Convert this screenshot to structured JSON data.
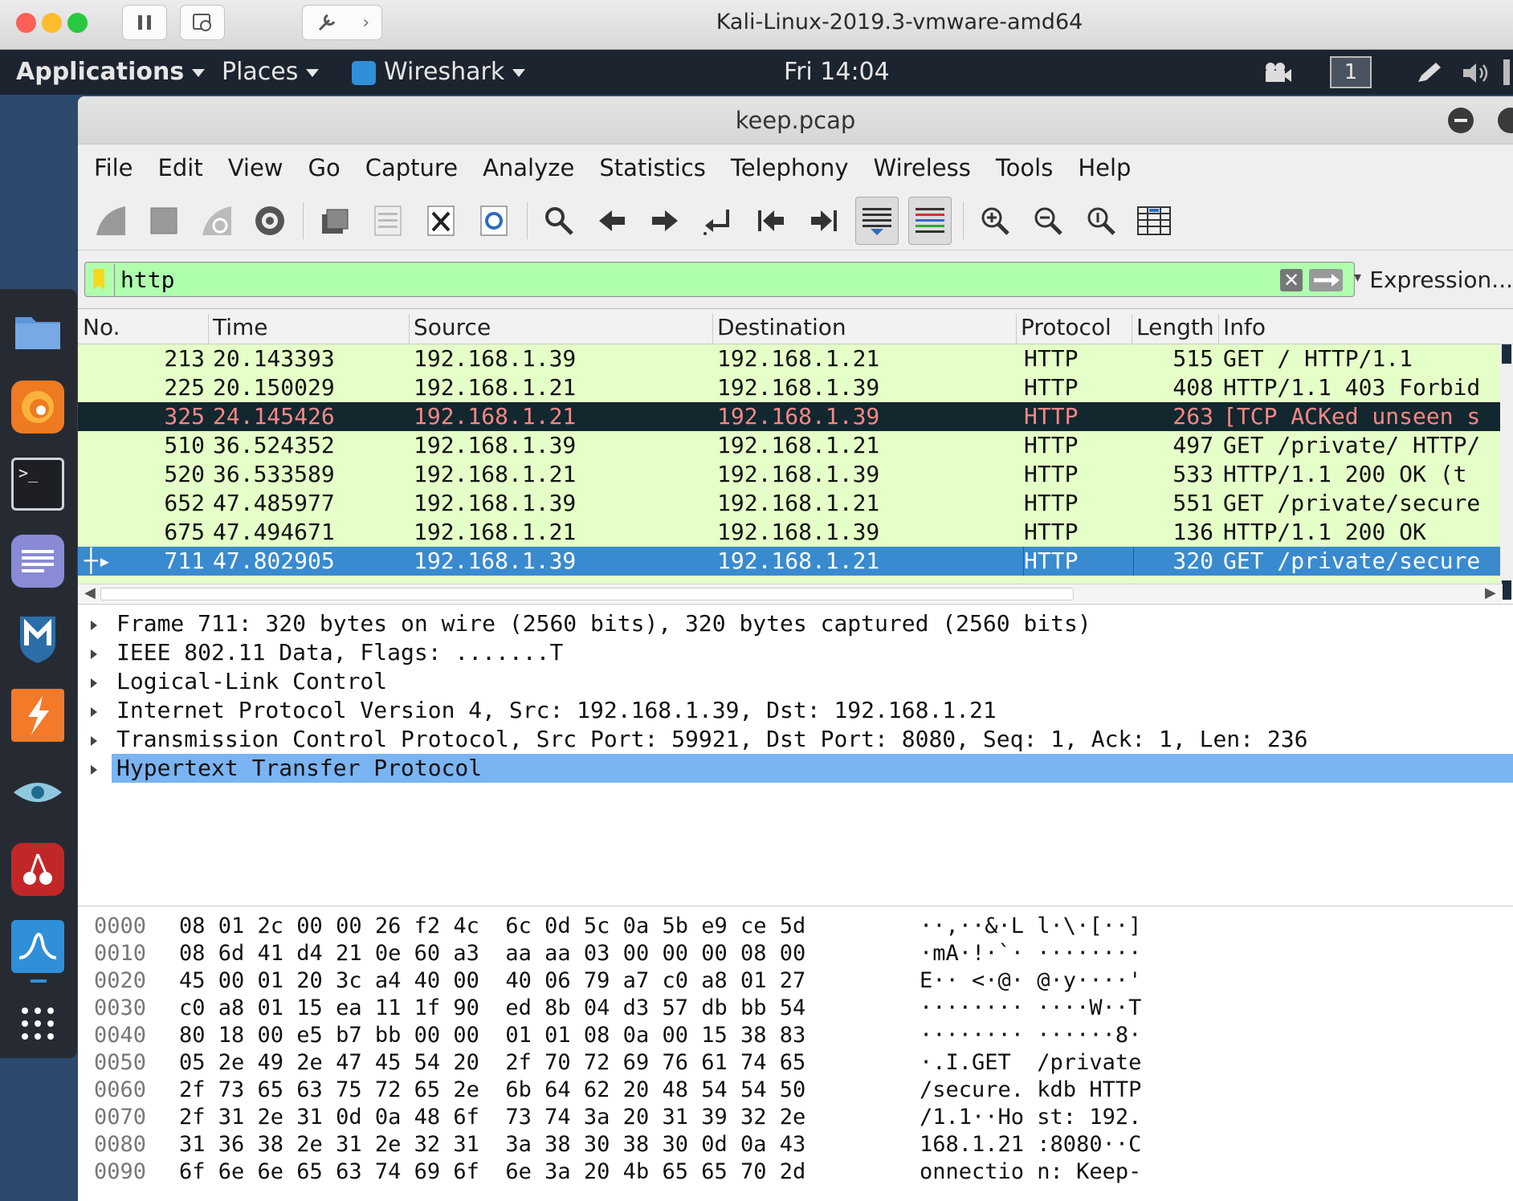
{
  "vm": {
    "title": "Kali-Linux-2019.3-vmware-amd64"
  },
  "gnome": {
    "applications": "Applications",
    "places": "Places",
    "app": "Wireshark",
    "clock": "Fri 14:04",
    "workspace": "1"
  },
  "window": {
    "title": "keep.pcap"
  },
  "menu": {
    "file": "File",
    "edit": "Edit",
    "view": "View",
    "go": "Go",
    "capture": "Capture",
    "analyze": "Analyze",
    "statistics": "Statistics",
    "telephony": "Telephony",
    "wireless": "Wireless",
    "tools": "Tools",
    "help": "Help"
  },
  "filter": {
    "value": "http",
    "expression": "Expression..."
  },
  "columns": {
    "no": "No.",
    "time": "Time",
    "source": "Source",
    "destination": "Destination",
    "protocol": "Protocol",
    "length": "Length",
    "info": "Info"
  },
  "packets": [
    {
      "no": "213",
      "time": "20.143393",
      "src": "192.168.1.39",
      "dst": "192.168.1.21",
      "proto": "HTTP",
      "len": "515",
      "info": "GET / HTTP/1.1",
      "style": "normal"
    },
    {
      "no": "225",
      "time": "20.150029",
      "src": "192.168.1.21",
      "dst": "192.168.1.39",
      "proto": "HTTP",
      "len": "408",
      "info": "HTTP/1.1 403 Forbid",
      "style": "normal"
    },
    {
      "no": "325",
      "time": "24.145426",
      "src": "192.168.1.21",
      "dst": "192.168.1.39",
      "proto": "HTTP",
      "len": "263",
      "info": "[TCP ACKed unseen s",
      "style": "bad"
    },
    {
      "no": "510",
      "time": "36.524352",
      "src": "192.168.1.39",
      "dst": "192.168.1.21",
      "proto": "HTTP",
      "len": "497",
      "info": "GET /private/ HTTP/",
      "style": "normal"
    },
    {
      "no": "520",
      "time": "36.533589",
      "src": "192.168.1.21",
      "dst": "192.168.1.39",
      "proto": "HTTP",
      "len": "533",
      "info": "HTTP/1.1 200 OK  (t",
      "style": "normal"
    },
    {
      "no": "652",
      "time": "47.485977",
      "src": "192.168.1.39",
      "dst": "192.168.1.21",
      "proto": "HTTP",
      "len": "551",
      "info": "GET /private/secure",
      "style": "normal"
    },
    {
      "no": "675",
      "time": "47.494671",
      "src": "192.168.1.21",
      "dst": "192.168.1.39",
      "proto": "HTTP",
      "len": "136",
      "info": "HTTP/1.1 200 OK",
      "style": "normal"
    },
    {
      "no": "711",
      "time": "47.802905",
      "src": "192.168.1.39",
      "dst": "192.168.1.21",
      "proto": "HTTP",
      "len": "320",
      "info": "GET /private/secure",
      "style": "selected"
    }
  ],
  "details": [
    "Frame 711: 320 bytes on wire (2560 bits), 320 bytes captured (2560 bits)",
    "IEEE 802.11 Data, Flags: .......T",
    "Logical-Link Control",
    "Internet Protocol Version 4, Src: 192.168.1.39, Dst: 192.168.1.21",
    "Transmission Control Protocol, Src Port: 59921, Dst Port: 8080, Seq: 1, Ack: 1, Len: 236",
    "Hypertext Transfer Protocol"
  ],
  "hex": [
    {
      "off": "0000",
      "bytes": "08 01 2c 00 00 26 f2 4c  6c 0d 5c 0a 5b e9 ce 5d",
      "ascii": "··,··&·L l·\\·[··]"
    },
    {
      "off": "0010",
      "bytes": "08 6d 41 d4 21 0e 60 a3  aa aa 03 00 00 00 08 00",
      "ascii": "·mA·!·`· ········"
    },
    {
      "off": "0020",
      "bytes": "45 00 01 20 3c a4 40 00  40 06 79 a7 c0 a8 01 27",
      "ascii": "E·· <·@· @·y····'"
    },
    {
      "off": "0030",
      "bytes": "c0 a8 01 15 ea 11 1f 90  ed 8b 04 d3 57 db bb 54",
      "ascii": "········ ····W··T"
    },
    {
      "off": "0040",
      "bytes": "80 18 00 e5 b7 bb 00 00  01 01 08 0a 00 15 38 83",
      "ascii": "········ ······8·"
    },
    {
      "off": "0050",
      "bytes": "05 2e 49 2e 47 45 54 20  2f 70 72 69 76 61 74 65",
      "ascii": "·.I.GET  /private"
    },
    {
      "off": "0060",
      "bytes": "2f 73 65 63 75 72 65 2e  6b 64 62 20 48 54 54 50",
      "ascii": "/secure. kdb HTTP"
    },
    {
      "off": "0070",
      "bytes": "2f 31 2e 31 0d 0a 48 6f  73 74 3a 20 31 39 32 2e",
      "ascii": "/1.1··Ho st: 192."
    },
    {
      "off": "0080",
      "bytes": "31 36 38 2e 31 2e 32 31  3a 38 30 38 30 0d 0a 43",
      "ascii": "168.1.21 :8080··C"
    },
    {
      "off": "0090",
      "bytes": "6f 6e 6e 65 63 74 69 6f  6e 3a 20 4b 65 65 70 2d",
      "ascii": "onnectio n: Keep-"
    }
  ],
  "colors": {
    "row_bg": "#e4ffc7",
    "bad_bg": "#12272e",
    "bad_fg": "#f78787",
    "selected_bg": "#3a8ad0",
    "detail_hl": "#7ab4f2",
    "filter_ok": "#afffaf"
  }
}
